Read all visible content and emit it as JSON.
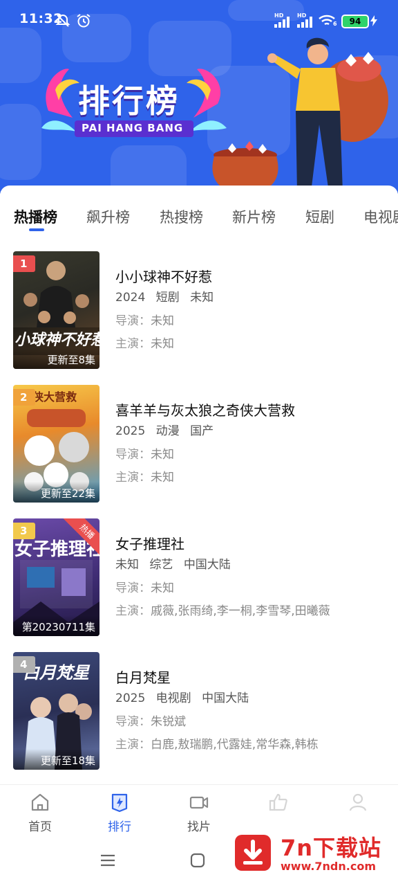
{
  "status_bar": {
    "time": "11:32",
    "battery": "94",
    "net1": "HD",
    "net2": "HD",
    "wifi_label": "6"
  },
  "banner": {
    "title_cn": "排行榜",
    "title_en": "PAI HANG BANG",
    "bg_color": "#2f63ea"
  },
  "tabs": [
    {
      "label": "热播榜",
      "active": true
    },
    {
      "label": "飙升榜",
      "active": false
    },
    {
      "label": "热搜榜",
      "active": false
    },
    {
      "label": "新片榜",
      "active": false
    },
    {
      "label": "短剧",
      "active": false
    },
    {
      "label": "电视剧",
      "active": false
    }
  ],
  "list": [
    {
      "rank": "1",
      "rank_color": "#e94f4f",
      "title": "小小球神不好惹",
      "meta": [
        "2024",
        "短剧",
        "未知"
      ],
      "director_label": "导演：",
      "director": "未知",
      "cast_label": "主演：",
      "cast": "未知",
      "badge": "更新至8集",
      "poster_text": "小球神不好惹",
      "ribbon": ""
    },
    {
      "rank": "2",
      "rank_color": "#f0a23a",
      "title": "喜羊羊与灰太狼之奇侠大营救",
      "meta": [
        "2025",
        "动漫",
        "国产"
      ],
      "director_label": "导演：",
      "director": "未知",
      "cast_label": "主演：",
      "cast": "未知",
      "badge": "更新至22集",
      "poster_text": "奇侠大营救",
      "ribbon": ""
    },
    {
      "rank": "3",
      "rank_color": "#f2c94c",
      "title": "女子推理社",
      "meta": [
        "未知",
        "综艺",
        "中国大陆"
      ],
      "director_label": "导演：",
      "director": "未知",
      "cast_label": "主演：",
      "cast": "戚薇,张雨绮,李一桐,李雪琴,田曦薇",
      "badge": "第20230711集",
      "poster_text": "女子推理社",
      "ribbon": "热播"
    },
    {
      "rank": "4",
      "rank_color": "#b0b0b0",
      "title": "白月梵星",
      "meta": [
        "2025",
        "电视剧",
        "中国大陆"
      ],
      "director_label": "导演：",
      "director": "朱锐斌",
      "cast_label": "主演：",
      "cast": "白鹿,敖瑞鹏,代露娃,常华森,韩栋",
      "badge": "更新至18集",
      "poster_text": "白月梵星",
      "ribbon": ""
    }
  ],
  "bottom_nav": [
    {
      "label": "首页",
      "icon": "home-icon",
      "active": false
    },
    {
      "label": "排行",
      "icon": "rank-icon",
      "active": true
    },
    {
      "label": "找片",
      "icon": "video-camera-icon",
      "active": false
    },
    {
      "label": "",
      "icon": "thumbs-up-icon",
      "active": false
    },
    {
      "label": "",
      "icon": "user-icon",
      "active": false
    }
  ],
  "watermark": {
    "title": "7n下载站",
    "url": "www.7ndn.com"
  },
  "colors": {
    "accent": "#2f63ea",
    "ribbon": "#e94f4f"
  }
}
